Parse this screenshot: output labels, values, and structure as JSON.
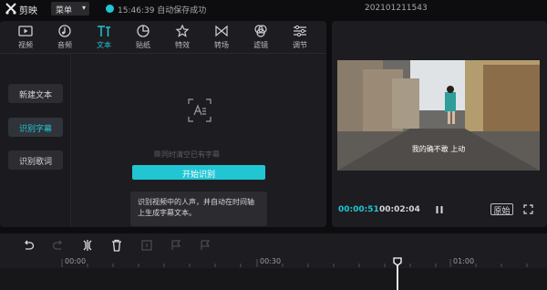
{
  "app": {
    "title": "剪映",
    "menu_label": "菜单",
    "save_time": "15:46:39",
    "save_status": "自动保存成功",
    "project_name": "202101211543",
    "accent_color": "#21c6d3"
  },
  "toolbar": {
    "items": [
      {
        "label": "视频",
        "icon": "video-icon"
      },
      {
        "label": "音频",
        "icon": "audio-icon"
      },
      {
        "label": "文本",
        "icon": "text-icon",
        "active": true
      },
      {
        "label": "贴纸",
        "icon": "sticker-icon"
      },
      {
        "label": "特效",
        "icon": "effects-icon"
      },
      {
        "label": "转场",
        "icon": "transition-icon"
      },
      {
        "label": "滤镜",
        "icon": "filter-icon"
      },
      {
        "label": "调节",
        "icon": "adjust-icon"
      }
    ]
  },
  "sidebar": {
    "items": [
      {
        "label": "新建文本"
      },
      {
        "label": "识别字幕",
        "active": true
      },
      {
        "label": "识别歌词"
      }
    ]
  },
  "recognize": {
    "clear_option": "同时清空已有字幕",
    "start_button": "开始识别",
    "description": "识别视频中的人声，并自动在时间轴上生成字幕文本。"
  },
  "player": {
    "subtitle": "我的确不敢  上动",
    "current_time": "00:00:51",
    "total_time": "00:02:04",
    "original_label": "原始"
  },
  "timeline": {
    "ticks": [
      "00:00",
      "00:30",
      "01:00"
    ]
  }
}
